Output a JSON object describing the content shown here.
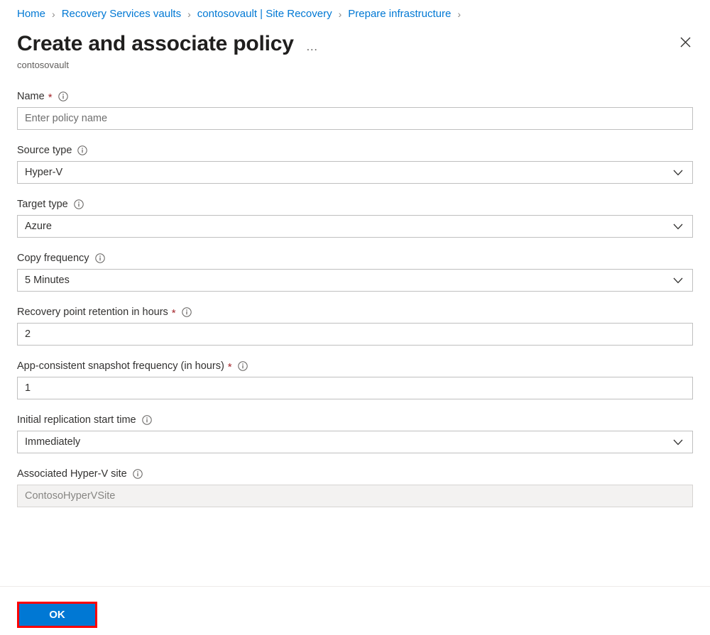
{
  "breadcrumb": {
    "items": [
      {
        "label": "Home"
      },
      {
        "label": "Recovery Services vaults"
      },
      {
        "label": "contosovault | Site Recovery"
      },
      {
        "label": "Prepare infrastructure"
      }
    ],
    "separator": "›"
  },
  "header": {
    "title": "Create and associate policy",
    "subtitle": "contosovault",
    "more_label": "…",
    "close_icon": "close-icon"
  },
  "form": {
    "fields": [
      {
        "key": "name",
        "label": "Name",
        "required": true,
        "type": "text",
        "value": "",
        "placeholder": "Enter policy name",
        "info_icon": "info-icon"
      },
      {
        "key": "source_type",
        "label": "Source type",
        "required": false,
        "type": "select",
        "value": "Hyper-V",
        "info_icon": "info-icon"
      },
      {
        "key": "target_type",
        "label": "Target type",
        "required": false,
        "type": "select",
        "value": "Azure",
        "info_icon": "info-icon"
      },
      {
        "key": "copy_frequency",
        "label": "Copy frequency",
        "required": false,
        "type": "select",
        "value": "5 Minutes",
        "info_icon": "info-icon"
      },
      {
        "key": "recovery_point_retention",
        "label": "Recovery point retention in hours",
        "required": true,
        "type": "text",
        "value": "2",
        "placeholder": "",
        "info_icon": "info-icon"
      },
      {
        "key": "app_consistent_snapshot_frequency",
        "label": "App-consistent snapshot frequency (in hours)",
        "required": true,
        "type": "text",
        "value": "1",
        "placeholder": "",
        "info_icon": "info-icon"
      },
      {
        "key": "initial_replication_start_time",
        "label": "Initial replication start time",
        "required": false,
        "type": "select",
        "value": "Immediately",
        "info_icon": "info-icon"
      },
      {
        "key": "associated_hyperv_site",
        "label": "Associated Hyper-V site",
        "required": false,
        "type": "text-disabled",
        "value": "ContosoHyperVSite",
        "placeholder": "",
        "info_icon": "info-icon"
      }
    ],
    "required_marker": "*"
  },
  "footer": {
    "ok_label": "OK"
  },
  "colors": {
    "accent": "#0078d4",
    "link": "#0078d4",
    "required": "#a4262c",
    "highlight": "#ff0000",
    "disabled_bg": "#f3f2f1",
    "border": "#bfbfbf",
    "text": "#323130",
    "muted": "#605e5c"
  }
}
